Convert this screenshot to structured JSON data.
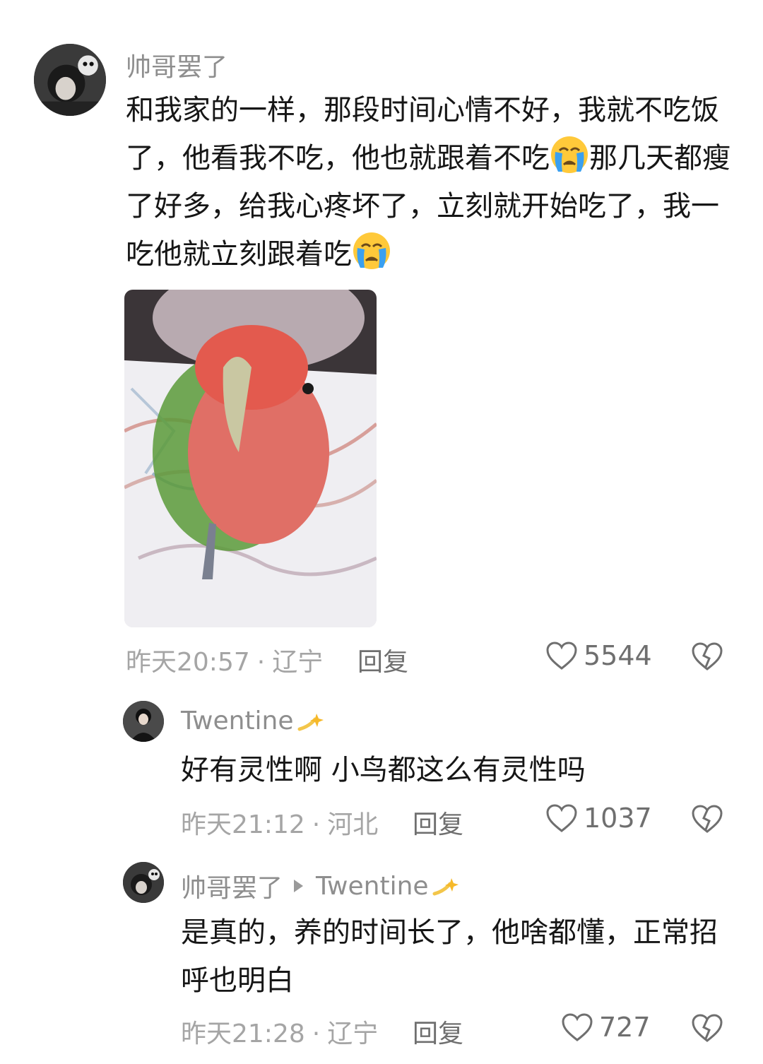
{
  "comments": [
    {
      "username": "帅哥罢了",
      "text_parts": [
        "和我家的一样，那段时间心情不好，我就不吃饭了，他看我不吃，他也就跟着不吃",
        "那几天都瘦了好多，给我心疼坏了，立刻就开始吃了，我一吃他就立刻跟着吃"
      ],
      "emoji": "crying-face-icon",
      "time": "昨天20:57",
      "location": "辽宁",
      "reply_label": "回复",
      "likes": "5544"
    },
    {
      "username": "Twentine",
      "text": "好有灵性啊 小鸟都这么有灵性吗",
      "time": "昨天21:12",
      "location": "河北",
      "reply_label": "回复",
      "likes": "1037"
    },
    {
      "username": "帅哥罢了",
      "reply_to": "Twentine",
      "text": "是真的，养的时间长了，他啥都懂，正常招呼也明白",
      "time": "昨天21:28",
      "location": "辽宁",
      "reply_label": "回复",
      "likes": "727"
    }
  ],
  "separator": "·",
  "colors": {
    "accent_gray": "#8e8e8e",
    "meta_gray": "#a5a5a5",
    "text": "#161616"
  }
}
